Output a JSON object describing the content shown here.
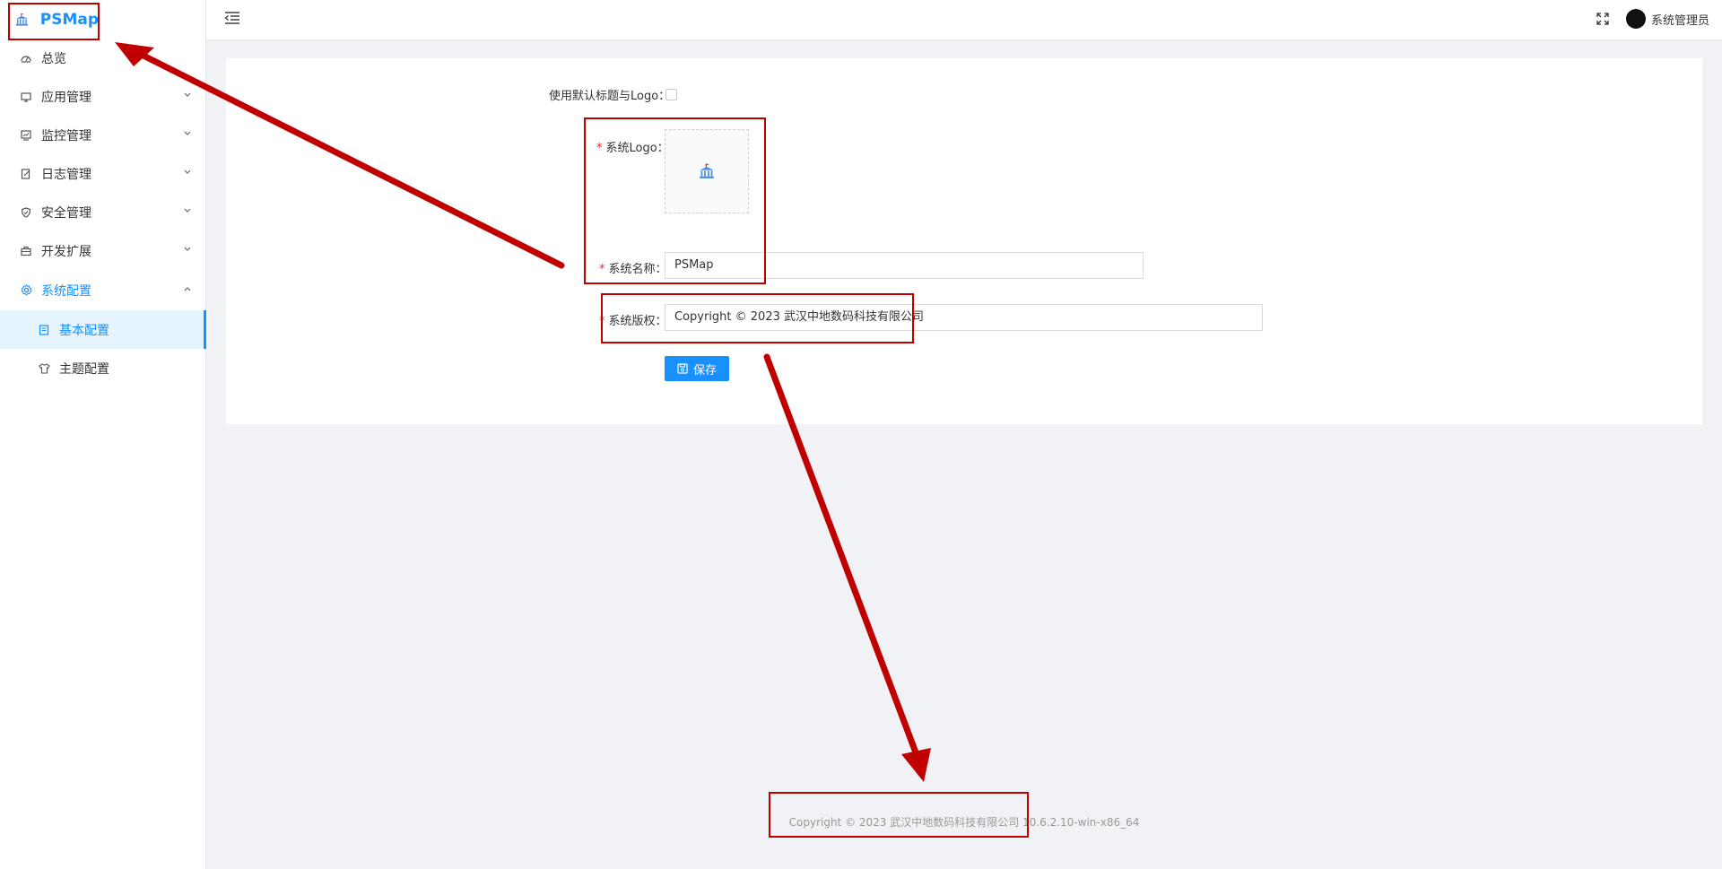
{
  "app": {
    "name": "PSMap"
  },
  "sidebar": {
    "items": [
      {
        "label": "总览",
        "icon": "dashboard-icon"
      },
      {
        "label": "应用管理",
        "icon": "monitor-icon"
      },
      {
        "label": "监控管理",
        "icon": "chart-monitor-icon"
      },
      {
        "label": "日志管理",
        "icon": "edit-log-icon"
      },
      {
        "label": "安全管理",
        "icon": "shield-icon"
      },
      {
        "label": "开发扩展",
        "icon": "toolbox-icon"
      },
      {
        "label": "系统配置",
        "icon": "gear-icon"
      }
    ],
    "subitems": [
      {
        "label": "基本配置",
        "icon": "form-icon"
      },
      {
        "label": "主题配置",
        "icon": "shirt-icon"
      }
    ]
  },
  "header": {
    "user_name": "系统管理员"
  },
  "form": {
    "use_default_label": "使用默认标题与Logo：",
    "logo_label": "系统Logo：",
    "name_label": "系统名称：",
    "name_value": "PSMap",
    "copyright_label": "系统版权：",
    "copyright_value": "Copyright © 2023 武汉中地数码科技有限公司",
    "required_mark": "*",
    "save_label": "保存"
  },
  "footer": {
    "text": "Copyright © 2023 武汉中地数码科技有限公司 10.6.2.10-win-x86_64"
  },
  "colors": {
    "accent": "#1890ff",
    "annotation": "#c00000"
  }
}
